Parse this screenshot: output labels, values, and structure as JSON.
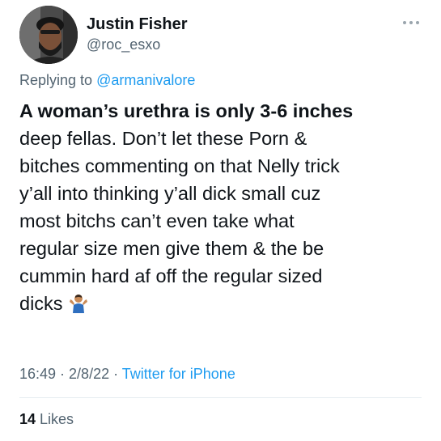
{
  "user": {
    "display_name": "Justin Fisher",
    "handle": "@roc_esxo"
  },
  "reply": {
    "prefix": "Replying to ",
    "to": "@armanivalore"
  },
  "tweet": {
    "bold_part": "A woman’s urethra is only 3-6 inches",
    "lines": [
      "deep fellas. Don’t let these Porn &",
      "bitches commenting on that Nelly trick",
      "y’all into thinking y’all dick small cuz",
      "most bitchs can’t even take what",
      "regular size men give them & the be",
      "cummin hard af off the regular sized",
      "dicks"
    ],
    "emoji": "person-shrugging-emoji"
  },
  "meta": {
    "time": "16:49",
    "separator": " · ",
    "date": "2/8/22",
    "source": "Twitter for iPhone"
  },
  "likes": {
    "count": "14",
    "label": " Likes"
  },
  "icons": {
    "more": "more-dots-icon"
  },
  "colors": {
    "text": "#0f1419",
    "secondary": "#536471",
    "link": "#1d9bf0",
    "divider": "#e6ecf0"
  }
}
